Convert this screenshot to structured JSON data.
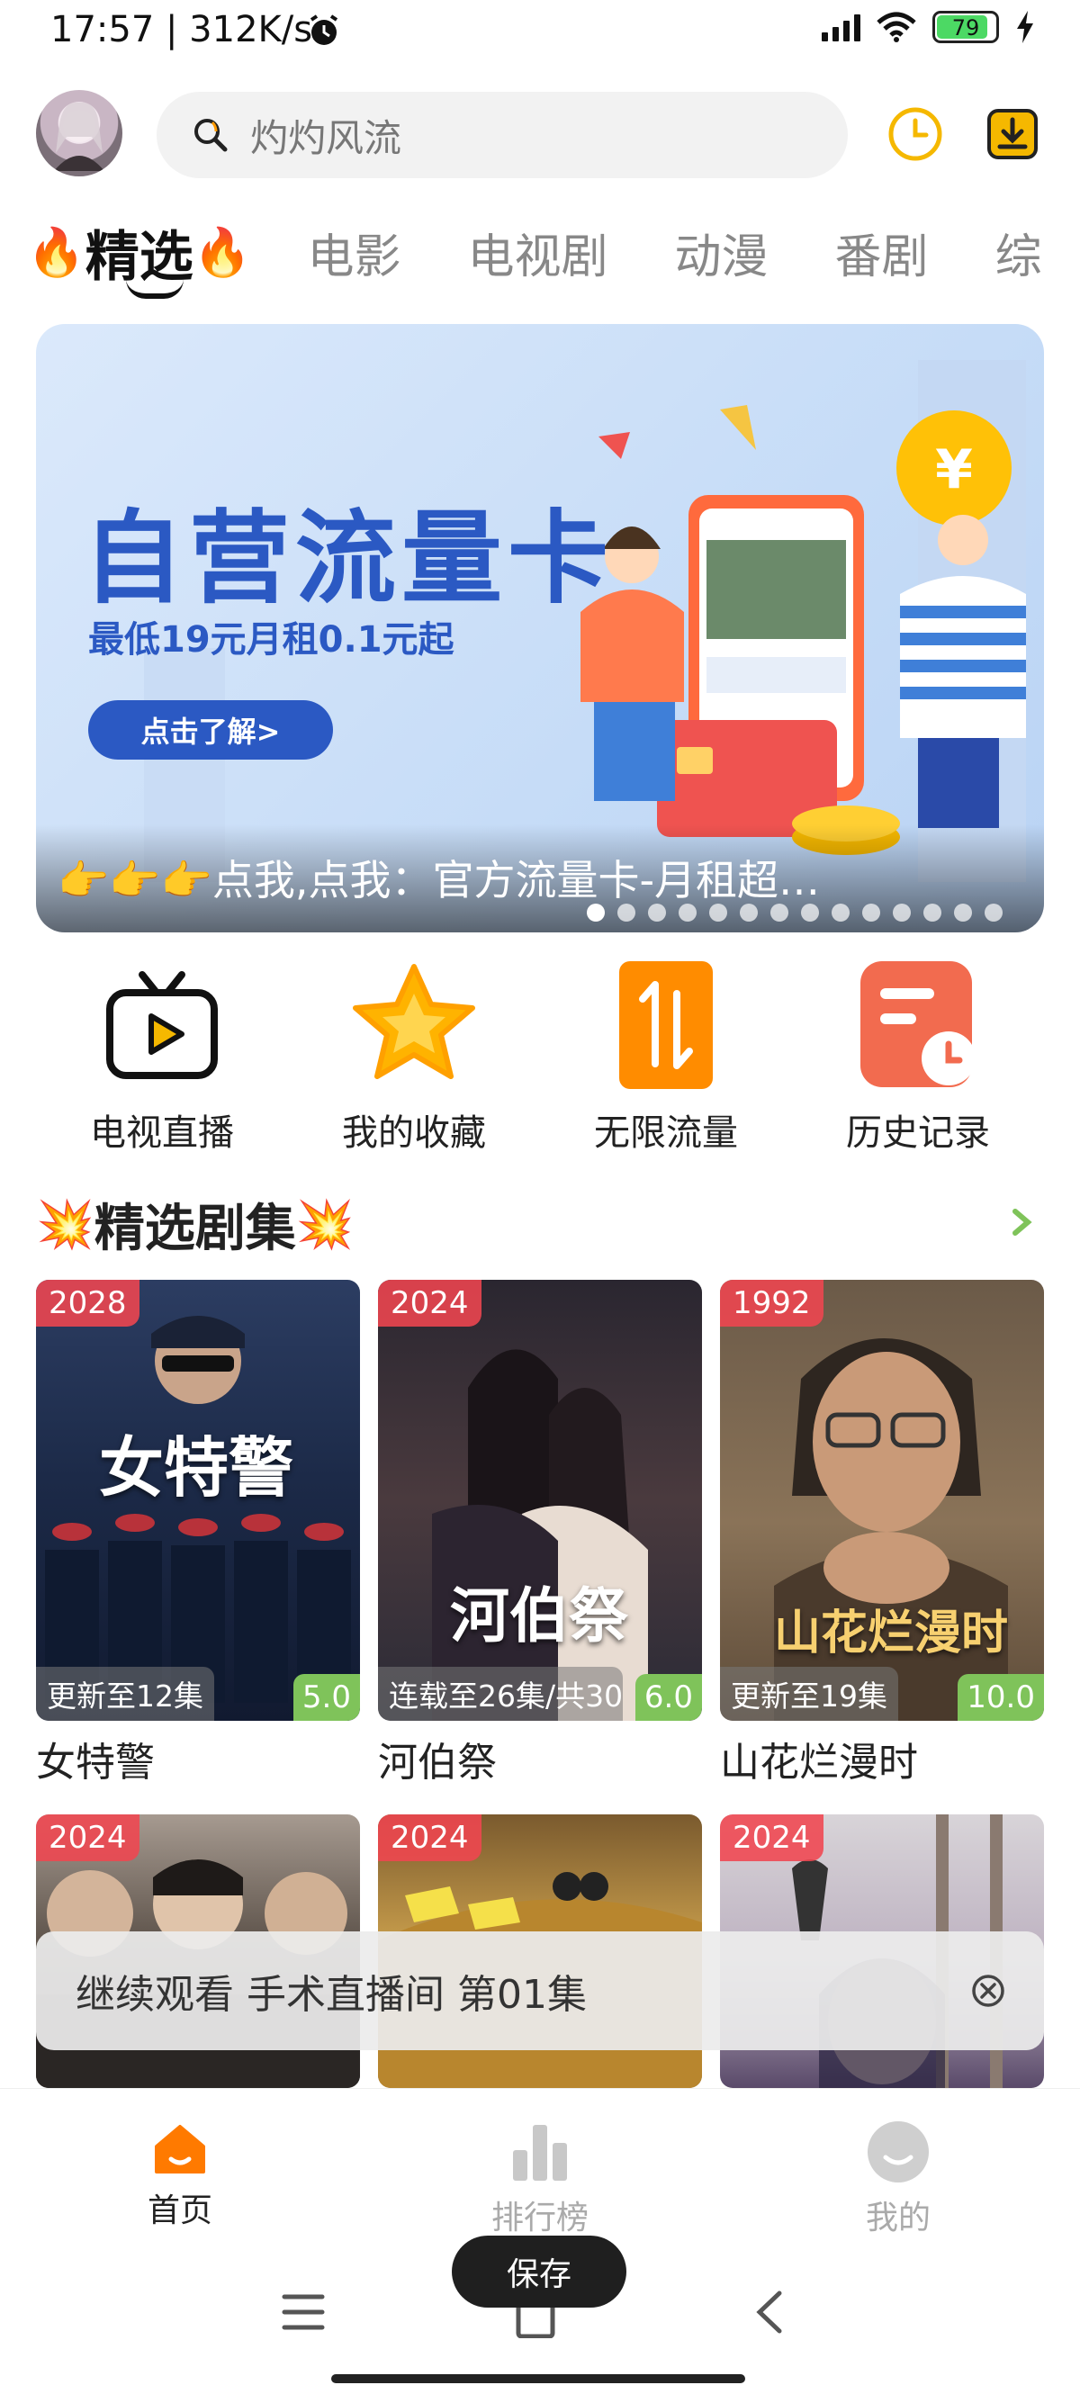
{
  "status_bar": {
    "time": "17:57 | 312K/s",
    "battery": "79"
  },
  "search": {
    "placeholder": "灼灼风流"
  },
  "category_tabs": {
    "active": "精选",
    "items": [
      "电影",
      "电视剧",
      "动漫",
      "番剧",
      "综"
    ]
  },
  "banner": {
    "title": "自营流量卡",
    "subtitle": "最低19元月租0.1元起",
    "button": "点击了解>",
    "caption": "👉👉👉点我,点我：官方流量卡-月租超…",
    "dot_count": 14,
    "active_dot": 0
  },
  "shortcuts": [
    {
      "label": "电视直播",
      "icon": "tv-play-icon"
    },
    {
      "label": "我的收藏",
      "icon": "star-icon"
    },
    {
      "label": "无限流量",
      "icon": "traffic-icon"
    },
    {
      "label": "历史记录",
      "icon": "history-icon"
    }
  ],
  "section": {
    "title": "精选剧集"
  },
  "cards": [
    {
      "year": "2028",
      "episode": "更新至12集",
      "rating": "5.0",
      "title": "女特警",
      "art": "女特警"
    },
    {
      "year": "2024",
      "episode": "连载至26集/共30",
      "rating": "6.0",
      "title": "河伯祭",
      "art": "河伯祭"
    },
    {
      "year": "1992",
      "episode": "更新至19集",
      "rating": "10.0",
      "title": "山花烂漫时",
      "art": "山花烂漫时"
    },
    {
      "year": "2024"
    },
    {
      "year": "2024"
    },
    {
      "year": "2024"
    }
  ],
  "continue_watching": {
    "text": "继续观看 手术直播间 第01集"
  },
  "bottom_nav": [
    {
      "label": "首页",
      "active": true
    },
    {
      "label": "排行榜",
      "active": false
    },
    {
      "label": "我的",
      "active": false
    }
  ],
  "toast": {
    "text": "保存"
  },
  "colors": {
    "accent": "#ff7a00",
    "banner_blue": "#2b59c3",
    "badge_red": "#f04650",
    "rating_green": "#7fc35a"
  }
}
